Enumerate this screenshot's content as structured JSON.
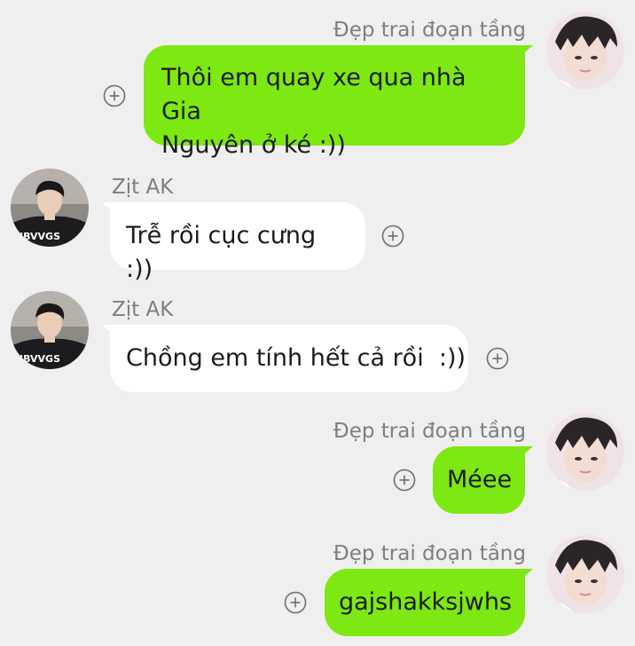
{
  "chat": {
    "messages": [
      {
        "sender": "Đẹp trai đoạn tầng",
        "side": "outgoing",
        "lines": [
          "Thôi em quay xe qua nhà Gia",
          "Nguyên ở ké :))"
        ],
        "avatar_icon": "user-avatar-icon",
        "action_icon": "add-circle-icon"
      },
      {
        "sender": "Zịt AK",
        "side": "incoming",
        "lines": [
          "Trễ rồi cục cưng :))"
        ],
        "avatar_icon": "user-avatar-icon",
        "action_icon": "add-circle-icon"
      },
      {
        "sender": "Zịt AK",
        "side": "incoming",
        "lines": [
          "Chồng em tính hết cả rồi  :))"
        ],
        "avatar_icon": "user-avatar-icon",
        "action_icon": "add-circle-icon"
      },
      {
        "sender": "Đẹp trai đoạn tầng",
        "side": "outgoing",
        "lines": [
          "Méee"
        ],
        "avatar_icon": "user-avatar-icon",
        "action_icon": "add-circle-icon"
      },
      {
        "sender": "Đẹp trai đoạn tầng",
        "side": "outgoing",
        "lines": [
          "gajshakksjwhs"
        ],
        "avatar_icon": "user-avatar-icon",
        "action_icon": "add-circle-icon"
      }
    ]
  },
  "colors": {
    "background": "#efefef",
    "outgoing_bubble": "#7ee812",
    "incoming_bubble": "#ffffff",
    "sender_name": "#7e7e7e"
  }
}
